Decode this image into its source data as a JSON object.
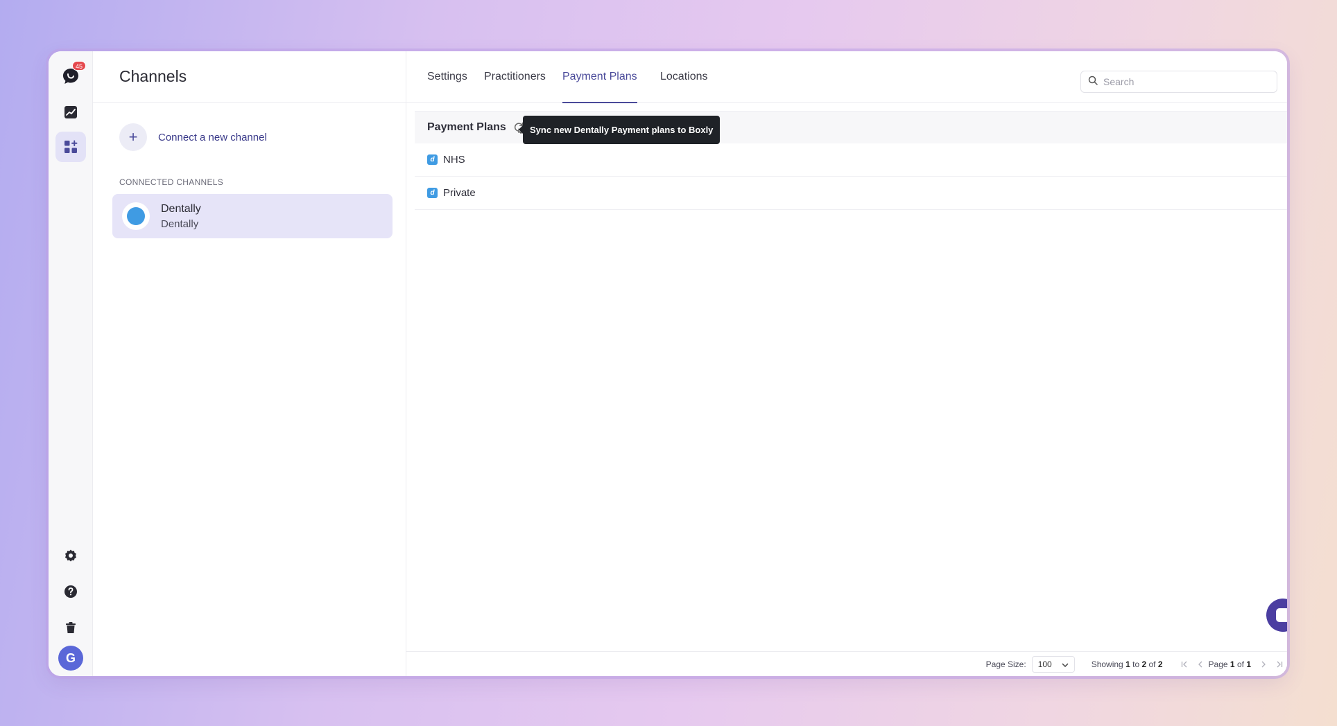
{
  "rail": {
    "notification_count": "45",
    "avatar_initial": "G"
  },
  "channels": {
    "title": "Channels",
    "connect_label": "Connect a new channel",
    "section_label": "CONNECTED CHANNELS",
    "items": [
      {
        "name": "Dentally",
        "sub": "Dentally"
      }
    ]
  },
  "tabs": [
    {
      "label": "Settings",
      "active": false
    },
    {
      "label": "Practitioners",
      "active": false
    },
    {
      "label": "Payment Plans",
      "active": true
    },
    {
      "label": "Locations",
      "active": false
    }
  ],
  "search": {
    "placeholder": "Search",
    "value": ""
  },
  "table": {
    "header": "Payment Plans",
    "tooltip": "Sync new Dentally Payment plans to Boxly",
    "row_icon_glyph": "d",
    "rows": [
      {
        "label": "NHS"
      },
      {
        "label": "Private"
      }
    ]
  },
  "footer": {
    "page_size_label": "Page Size:",
    "page_size_value": "100",
    "showing_prefix": "Showing",
    "showing_from": "1",
    "showing_to_word": "to",
    "showing_to": "2",
    "showing_of_word": "of",
    "showing_total": "2",
    "page_prefix": "Page",
    "page_current": "1",
    "page_of_word": "of",
    "page_total": "1"
  },
  "colors": {
    "accent": "#4a4a9a",
    "active_card": "#e6e4f8",
    "badge": "#e5484d",
    "dentally_blue": "#3f9be3",
    "tooltip_bg": "#1f2227"
  }
}
